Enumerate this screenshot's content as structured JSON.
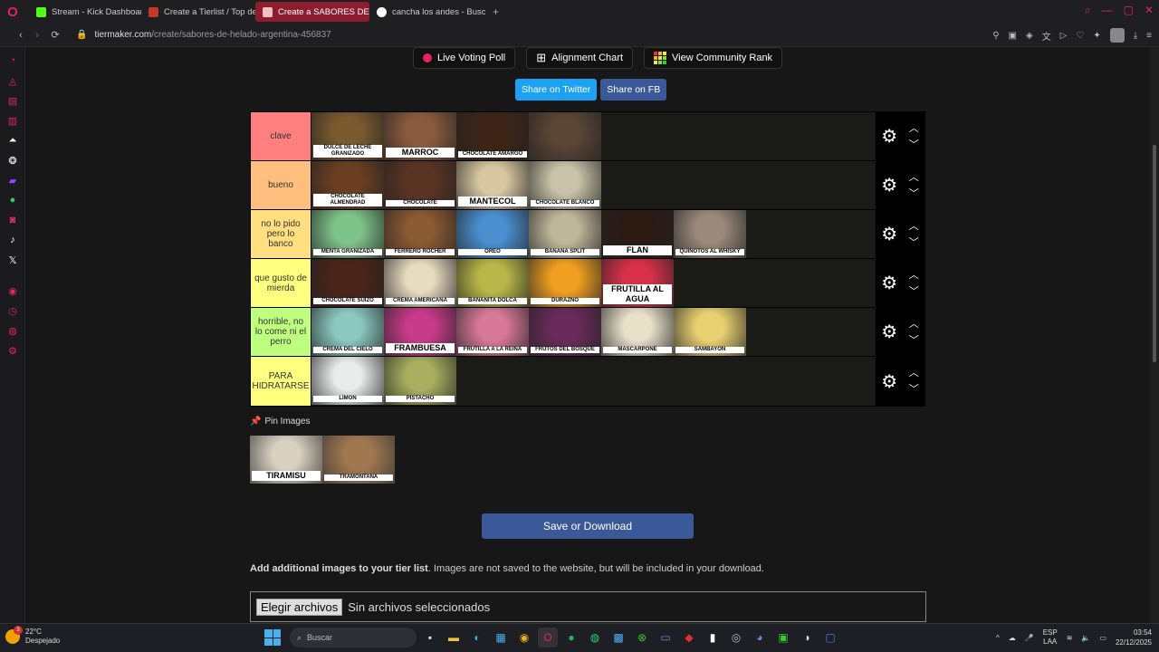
{
  "browser": {
    "tabs": [
      {
        "label": "Stream - Kick Dashboard",
        "icon": "kick-icon",
        "color": "#53fc18",
        "active": false
      },
      {
        "label": "Create a Tierlist / Top de",
        "icon": "tiermaker-icon",
        "color": "#c0392b",
        "active": false
      },
      {
        "label": "Create a SABORES DE HE",
        "icon": "tiermaker-icon",
        "color": "#c0392b",
        "active": true
      },
      {
        "label": "cancha los andes - Busca",
        "icon": "google-icon",
        "color": "#4285f4",
        "active": false
      }
    ],
    "url_host": "tiermaker.com",
    "url_path": "/create/sabores-de-helado-argentina-456837"
  },
  "top_buttons": {
    "live_voting": "Live Voting Poll",
    "alignment": "Alignment Chart",
    "community": "View Community Rank"
  },
  "share": {
    "twitter": "Share on Twitter",
    "fb": "Share on FB"
  },
  "tiers": [
    {
      "label": "clave",
      "color": "#ff7f7f",
      "items": [
        {
          "name": "DULCE DE LECHE GRANIZADO",
          "bg": "#7a5a2e"
        },
        {
          "name": "MARROC",
          "bg": "#8a5a3e",
          "big": true
        },
        {
          "name": "CHOCOLATE AMARGO",
          "bg": "#3d2417"
        },
        {
          "name": "",
          "bg": "#5a4636"
        }
      ]
    },
    {
      "label": "bueno",
      "color": "#ffbf7f",
      "items": [
        {
          "name": "CHOCOLATE ALMENDRAD",
          "bg": "#6b3e22"
        },
        {
          "name": "CHOCOLATE",
          "bg": "#5a3422"
        },
        {
          "name": "MANTECOL",
          "bg": "#d8c7a0",
          "big": true
        },
        {
          "name": "CHOCOLATE BLANCO",
          "bg": "#c9c2a8"
        }
      ]
    },
    {
      "label": "no lo pido pero lo banco",
      "color": "#ffdf7f",
      "items": [
        {
          "name": "MENTA GRANIZADA",
          "bg": "#7ec48a"
        },
        {
          "name": "FERRERO ROCHER",
          "bg": "#8a5a32"
        },
        {
          "name": "OREO",
          "bg": "#4a8fd0"
        },
        {
          "name": "BANANA SPLIT",
          "bg": "#bfb79a"
        },
        {
          "name": "FLAN",
          "bg": "#2a1a12",
          "big": true
        },
        {
          "name": "QUINOTOS AL WHISKY",
          "bg": "#9a8a7a"
        }
      ]
    },
    {
      "label": "que gusto de mierda",
      "color": "#ffff7f",
      "items": [
        {
          "name": "CHOCOLATE SUIZO",
          "bg": "#4a2418"
        },
        {
          "name": "CREMA AMERICANA",
          "bg": "#e8dcc0"
        },
        {
          "name": "BANANITA DOLCA",
          "bg": "#b8b848"
        },
        {
          "name": "DURAZNO",
          "bg": "#f0a020"
        },
        {
          "name": "FRUTILLA AL AGUA",
          "bg": "#d8304a",
          "big": true
        }
      ]
    },
    {
      "label": "horrible, no lo come ni el perro",
      "color": "#bfff7f",
      "items": [
        {
          "name": "CREMA DEL CIELO",
          "bg": "#8ac8c0"
        },
        {
          "name": "FRAMBUESA",
          "bg": "#c83a8a",
          "big": true
        },
        {
          "name": "FRUTILLA A LA REINA",
          "bg": "#d87898"
        },
        {
          "name": "FRUTOS DEL BOSQUE",
          "bg": "#6a2a5a"
        },
        {
          "name": "MASCARPONE",
          "bg": "#e8e0c8"
        },
        {
          "name": "SAMBAYON",
          "bg": "#e8d070"
        }
      ]
    },
    {
      "label": "PARA HIDRATARSE",
      "color": "#ffff7f",
      "items": [
        {
          "name": "LIMON",
          "bg": "#e8ecea"
        },
        {
          "name": "PISTACHO",
          "bg": "#a8b060"
        }
      ]
    }
  ],
  "pin": {
    "label": "Pin Images",
    "items": [
      {
        "name": "TIRAMISU",
        "bg": "#d8d0c0",
        "big": true
      },
      {
        "name": "TRAMONTANA",
        "bg": "#a07850"
      }
    ]
  },
  "save_label": "Save or Download",
  "add_images": {
    "bold": "Add additional images to your tier list",
    "rest": ". Images are not saved to the website, but will be included in your download."
  },
  "file_input": {
    "button": "Elegir archivos",
    "status": "Sin archivos seleccionados"
  },
  "taskbar": {
    "temp": "22°C",
    "weather": "Despejado",
    "badge": "3",
    "search": "Buscar",
    "lang1": "ESP",
    "lang2": "LAA",
    "time": "03:54",
    "date": "22/12/2025"
  }
}
